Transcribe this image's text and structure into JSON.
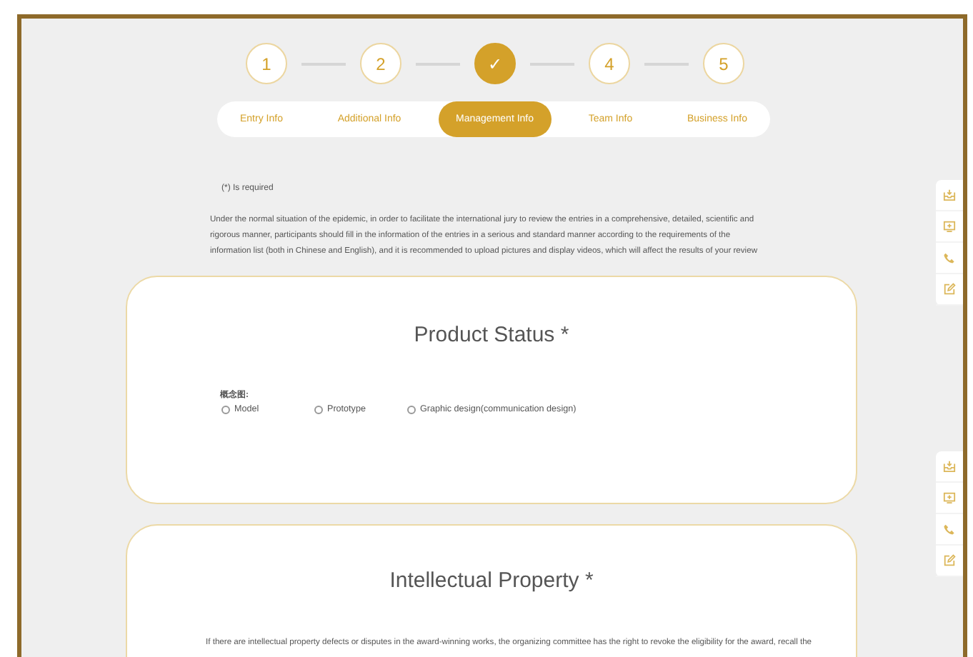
{
  "steps": [
    {
      "label": "1",
      "selected": false
    },
    {
      "label": "2",
      "selected": false
    },
    {
      "label": "✓",
      "selected": true
    },
    {
      "label": "4",
      "selected": false
    },
    {
      "label": "5",
      "selected": false
    }
  ],
  "tabs": [
    {
      "label": "Entry Info",
      "selected": false
    },
    {
      "label": "Additional Info",
      "selected": false
    },
    {
      "label": "Management Info",
      "selected": true
    },
    {
      "label": "Team Info",
      "selected": false
    },
    {
      "label": "Business Info",
      "selected": false
    }
  ],
  "required_note": "(*)  Is required",
  "intro": "Under the normal situation of the epidemic, in order to facilitate the international jury to review the entries in a comprehensive, detailed, scientific and rigorous manner, participants should fill in the information of the entries in a serious and standard manner according to the requirements of the information list (both in Chinese and English), and it is recommended to upload pictures and display videos, which will affect the results of your review",
  "product_status": {
    "title": "Product Status *",
    "group_label": "概念图:",
    "options": [
      {
        "label": "Model",
        "selected": false
      },
      {
        "label": "Prototype",
        "selected": false
      },
      {
        "label": "Graphic design(communication design)",
        "selected": false
      }
    ]
  },
  "intellectual_property": {
    "title": "Intellectual Property *",
    "text": "If there are intellectual property defects or disputes in the award-winning works, the organizing committee has the right to revoke the eligibility for the award, recall the"
  }
}
